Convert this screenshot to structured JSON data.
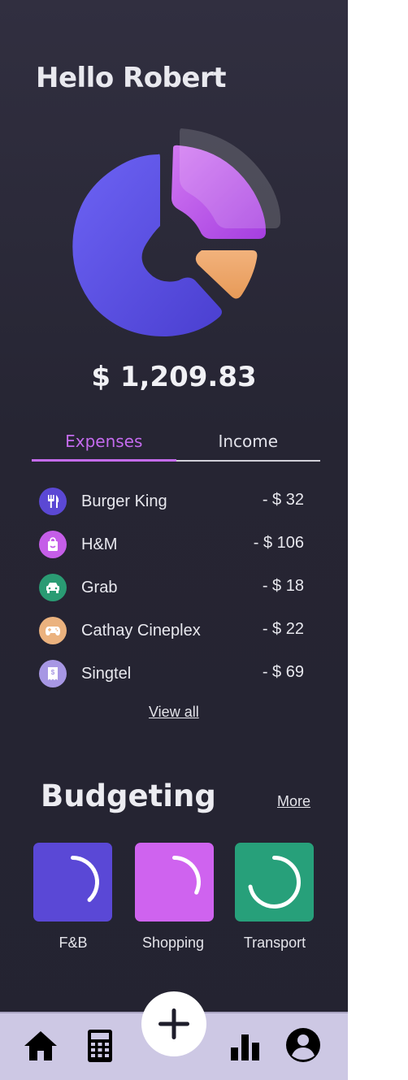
{
  "greeting": "Hello Robert",
  "balance": "$ 1,209.83",
  "tabs": {
    "expenses": "Expenses",
    "income": "Income"
  },
  "transactions": [
    {
      "name": "Burger King",
      "amount": "- $ 32",
      "icon": "fork-knife-icon",
      "color": "#5b48d4"
    },
    {
      "name": "H&M",
      "amount": "- $ 106",
      "icon": "shopping-bag-icon",
      "color": "#c55ee8"
    },
    {
      "name": "Grab",
      "amount": "- $ 18",
      "icon": "car-icon",
      "color": "#2a9b73"
    },
    {
      "name": "Cathay Cineplex",
      "amount": "- $ 22",
      "icon": "gamepad-icon",
      "color": "#ebb27e"
    },
    {
      "name": "Singtel",
      "amount": "- $ 69",
      "icon": "bill-icon",
      "color": "#a797e4"
    }
  ],
  "view_all": "View all",
  "budgeting": {
    "title": "Budgeting",
    "more": "More",
    "cards": [
      {
        "label": "F&B",
        "color": "#5a48d6",
        "progress": 0.38
      },
      {
        "label": "Shopping",
        "color": "#cf63ef",
        "progress": 0.32
      },
      {
        "label": "Transport",
        "color": "#27a07a",
        "progress": 0.72
      }
    ]
  },
  "colors": {
    "accent": "#c46bee",
    "background": "#262533",
    "nav_background": "#cdc8e4"
  },
  "nav": [
    "home-icon",
    "calculator-icon",
    "add-icon",
    "bar-chart-icon",
    "user-account-icon"
  ]
}
